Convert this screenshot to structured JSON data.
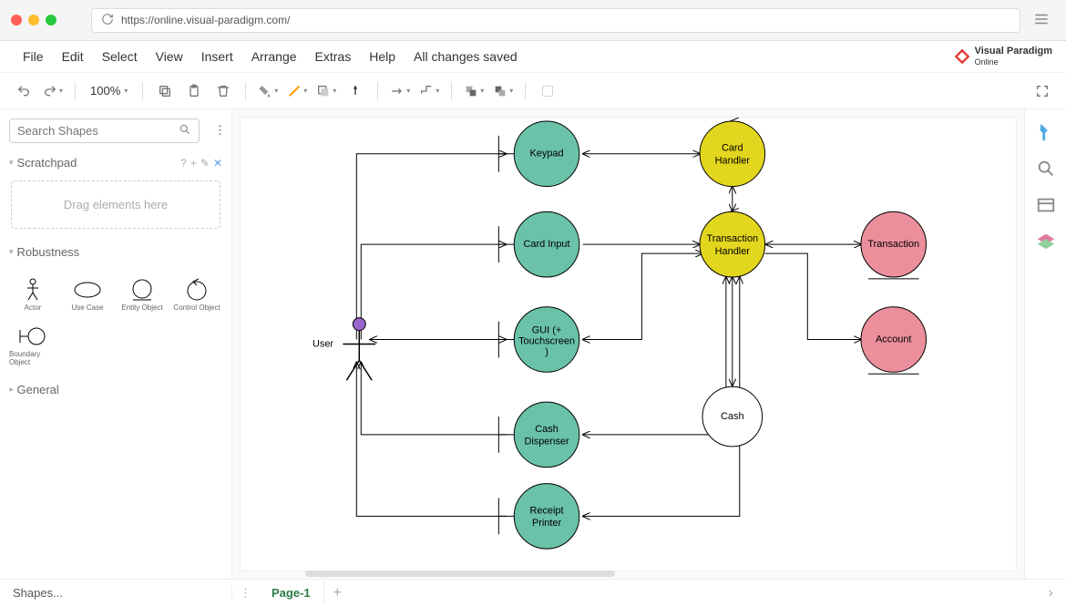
{
  "url": "https://online.visual-paradigm.com/",
  "brand": {
    "name": "Visual Paradigm",
    "sub": "Online"
  },
  "menu": {
    "file": "File",
    "edit": "Edit",
    "select": "Select",
    "view": "View",
    "insert": "Insert",
    "arrange": "Arrange",
    "extras": "Extras",
    "help": "Help",
    "status": "All changes saved"
  },
  "toolbar": {
    "zoom": "100%"
  },
  "sidebar": {
    "search_placeholder": "Search Shapes",
    "scratchpad_title": "Scratchpad",
    "dropzone": "Drag elements here",
    "robustness_title": "Robustness",
    "palette": {
      "actor": "Actor",
      "usecase": "Use Case",
      "entity": "Entity Object",
      "control": "Control Object",
      "boundary": "Boundary Object"
    },
    "general_title": "General",
    "shapes_link": "Shapes..."
  },
  "page_tab": "Page-1",
  "diagram": {
    "actor_label": "User",
    "nodes": {
      "keypad": "Keypad",
      "card_handler": "Card\nHandler",
      "card_input": "Card Input",
      "transaction_handler": "Transaction\nHandler",
      "transaction": "Transaction",
      "gui": "GUI (+\nTouchscreen\n)",
      "account": "Account",
      "cash": "Cash",
      "cash_dispenser": "Cash\nDispenser",
      "receipt_printer": "Receipt\nPrinter"
    }
  },
  "chart_data": {
    "type": "robustness_diagram",
    "actors": [
      "User"
    ],
    "boundary_objects": [
      "Keypad",
      "Card Input",
      "GUI (+ Touchscreen)",
      "Cash Dispenser",
      "Receipt Printer"
    ],
    "control_objects": [
      "Card Handler",
      "Transaction Handler"
    ],
    "entity_objects": [
      "Transaction",
      "Account"
    ],
    "plain_objects": [
      "Cash"
    ],
    "associations": [
      [
        "User",
        "Keypad"
      ],
      [
        "User",
        "Card Input"
      ],
      [
        "User",
        "GUI (+ Touchscreen)"
      ],
      [
        "User",
        "Cash Dispenser"
      ],
      [
        "User",
        "Receipt Printer"
      ],
      [
        "Keypad",
        "Card Handler"
      ],
      [
        "Card Input",
        "Transaction Handler"
      ],
      [
        "GUI (+ Touchscreen)",
        "Transaction Handler"
      ],
      [
        "Card Handler",
        "Transaction Handler"
      ],
      [
        "Transaction Handler",
        "Transaction"
      ],
      [
        "Transaction Handler",
        "Account"
      ],
      [
        "Transaction Handler",
        "Cash"
      ],
      [
        "Transaction Handler",
        "Cash Dispenser"
      ],
      [
        "Transaction Handler",
        "Receipt Printer"
      ]
    ]
  }
}
